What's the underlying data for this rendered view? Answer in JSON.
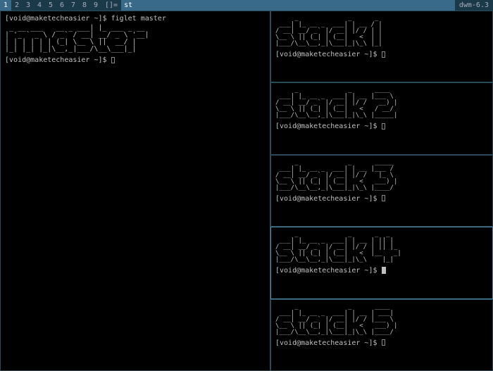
{
  "statusbar": {
    "tags": [
      "1",
      "2",
      "3",
      "4",
      "5",
      "6",
      "7",
      "8",
      "9"
    ],
    "selected_tag_index": 0,
    "layout_symbol": "[]=",
    "window_title": "st",
    "status_right": "dwm-6.3"
  },
  "master": {
    "prompt1_user": "void",
    "prompt1_host": "maketecheasier",
    "prompt1_path": "~",
    "prompt1_cmd": "figlet master",
    "ascii": " _ __ ___   __ _ ___| |_ ___ _ __ \n| '_ ` _ \\ / _` / __| __/ _ \\ '__|\n| | | | | | (_| \\__ \\ ||  __/ |   \n|_| |_| |_|\\__,_|___/\\__\\___|_|   ",
    "prompt2_user": "void",
    "prompt2_host": "maketecheasier",
    "prompt2_path": "~"
  },
  "stacks": [
    {
      "ascii": "     _             _      _ \n ___| |_ __ _  ___| | __ / |\n/ __| __/ _` |/ __| |/ / | |\n\\__ \\ || (_| | (__|   <  | |\n|___/\\__\\__,_|\\___|_|\\_\\ |_|",
      "prompt_user": "void",
      "prompt_host": "maketecheasier",
      "prompt_path": "~",
      "focused": false
    },
    {
      "ascii": "     _             _      ____  \n ___| |_ __ _  ___| | __ |___ \\ \n/ __| __/ _` |/ __| |/ /   __) |\n\\__ \\ || (_| | (__|   <   / __/ \n|___/\\__\\__,_|\\___|_|\\_\\ |_____|",
      "prompt_user": "void",
      "prompt_host": "maketecheasier",
      "prompt_path": "~",
      "focused": false
    },
    {
      "ascii": "     _             _      _____ \n ___| |_ __ _  ___| | __ |___ / \n/ __| __/ _` |/ __| |/ /   |_ \\ \n\\__ \\ || (_| | (__|   <   ___) |\n|___/\\__\\__,_|\\___|_|\\_\\ |____/ ",
      "prompt_user": "void",
      "prompt_host": "maketecheasier",
      "prompt_path": "~",
      "focused": false
    },
    {
      "ascii": "     _             _      _  _   \n ___| |_ __ _  ___| | __ | || |  \n/ __| __/ _` |/ __| |/ / | || |_ \n\\__ \\ || (_| | (__|   <  |__   _|\n|___/\\__\\__,_|\\___|_|\\_\\    |_|  ",
      "prompt_user": "void",
      "prompt_host": "maketecheasier",
      "prompt_path": "~",
      "focused": true
    },
    {
      "ascii": "     _             _      ____  \n ___| |_ __ _  ___| | __ | ___| \n/ __| __/ _` |/ __| |/ / |___ \\ \n\\__ \\ || (_| | (__|   <   ___) |\n|___/\\__\\__,_|\\___|_|\\_\\ |____/ ",
      "prompt_user": "void",
      "prompt_host": "maketecheasier",
      "prompt_path": "~",
      "focused": false
    }
  ]
}
